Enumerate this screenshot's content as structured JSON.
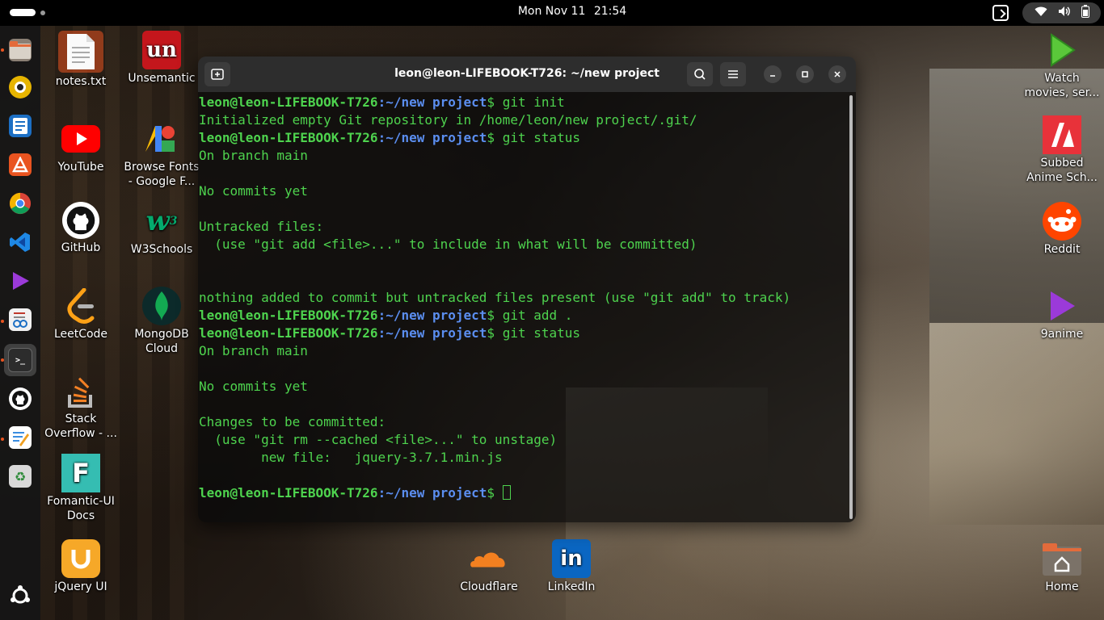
{
  "topbar": {
    "date": "Mon Nov 11",
    "time": "21:54"
  },
  "dock": {
    "items": [
      {
        "name": "files",
        "label": "Files"
      },
      {
        "name": "rhythmbox",
        "label": "Rhythmbox"
      },
      {
        "name": "libreoffice-writer",
        "label": "LibreOffice Writer"
      },
      {
        "name": "app-center",
        "label": "App Center"
      },
      {
        "name": "chrome",
        "label": "Google Chrome"
      },
      {
        "name": "vscode",
        "label": "Visual Studio Code"
      },
      {
        "name": "9anime",
        "label": "9anime"
      },
      {
        "name": "document-viewer",
        "label": "Document Viewer"
      },
      {
        "name": "terminal",
        "label": "Terminal"
      },
      {
        "name": "github",
        "label": "GitHub"
      },
      {
        "name": "text-editor",
        "label": "Text Editor"
      },
      {
        "name": "trash",
        "label": "Trash"
      },
      {
        "name": "show-apps",
        "label": "Show Apps"
      }
    ]
  },
  "desktop": {
    "icons": [
      {
        "id": "notes",
        "label": "notes.txt"
      },
      {
        "id": "unsemantic",
        "label": "Unsemantic"
      },
      {
        "id": "youtube",
        "label": "YouTube"
      },
      {
        "id": "browse-fonts",
        "label_1": "Browse Fonts",
        "label_2": "- Google F..."
      },
      {
        "id": "github",
        "label": "GitHub"
      },
      {
        "id": "w3schools",
        "label": "W3Schools"
      },
      {
        "id": "leetcode",
        "label": "LeetCode"
      },
      {
        "id": "mongodb",
        "label_1": "MongoDB",
        "label_2": "Cloud"
      },
      {
        "id": "stackoverflow",
        "label_1": "Stack",
        "label_2": "Overflow - ..."
      },
      {
        "id": "fomantic",
        "label_1": "Fomantic-UI",
        "label_2": "Docs"
      },
      {
        "id": "jqueryui",
        "label": "jQuery UI"
      },
      {
        "id": "cloudflare",
        "label": "Cloudflare"
      },
      {
        "id": "linkedin",
        "label": "LinkedIn"
      },
      {
        "id": "watch-movies",
        "label_1": "Watch",
        "label_2": "movies, ser..."
      },
      {
        "id": "subbed-anime",
        "label_1": "Subbed",
        "label_2": "Anime Sch..."
      },
      {
        "id": "reddit",
        "label": "Reddit"
      },
      {
        "id": "9anime",
        "label": "9anime"
      },
      {
        "id": "home",
        "label": "Home"
      }
    ]
  },
  "terminal": {
    "title": "leon@leon-LIFEBOOK-T726: ~/new project",
    "prompt_user": "leon@leon-LIFEBOOK-T726",
    "prompt_path": ":~/new project",
    "lines": [
      {
        "type": "prompt",
        "cmd": " git init"
      },
      {
        "type": "out",
        "text": "Initialized empty Git repository in /home/leon/new project/.git/"
      },
      {
        "type": "prompt",
        "cmd": " git status"
      },
      {
        "type": "out",
        "text": "On branch main"
      },
      {
        "type": "out",
        "text": ""
      },
      {
        "type": "out",
        "text": "No commits yet"
      },
      {
        "type": "out",
        "text": ""
      },
      {
        "type": "out",
        "text": "Untracked files:"
      },
      {
        "type": "out",
        "text": "  (use \"git add <file>...\" to include in what will be committed)"
      },
      {
        "type": "out",
        "text": ""
      },
      {
        "type": "out",
        "text": ""
      },
      {
        "type": "out",
        "text": "nothing added to commit but untracked files present (use \"git add\" to track)"
      },
      {
        "type": "prompt",
        "cmd": " git add ."
      },
      {
        "type": "prompt",
        "cmd": " git status"
      },
      {
        "type": "out",
        "text": "On branch main"
      },
      {
        "type": "out",
        "text": ""
      },
      {
        "type": "out",
        "text": "No commits yet"
      },
      {
        "type": "out",
        "text": ""
      },
      {
        "type": "out",
        "text": "Changes to be committed:"
      },
      {
        "type": "out",
        "text": "  (use \"git rm --cached <file>...\" to unstage)"
      },
      {
        "type": "out",
        "text": "        new file:   jquery-3.7.1.min.js"
      },
      {
        "type": "out",
        "text": ""
      },
      {
        "type": "prompt",
        "cmd": " ",
        "cursor": true
      }
    ]
  },
  "colors": {
    "terminal_green": "#4ed34e",
    "terminal_blue": "#5b8ef0",
    "accent": "#e95420"
  }
}
